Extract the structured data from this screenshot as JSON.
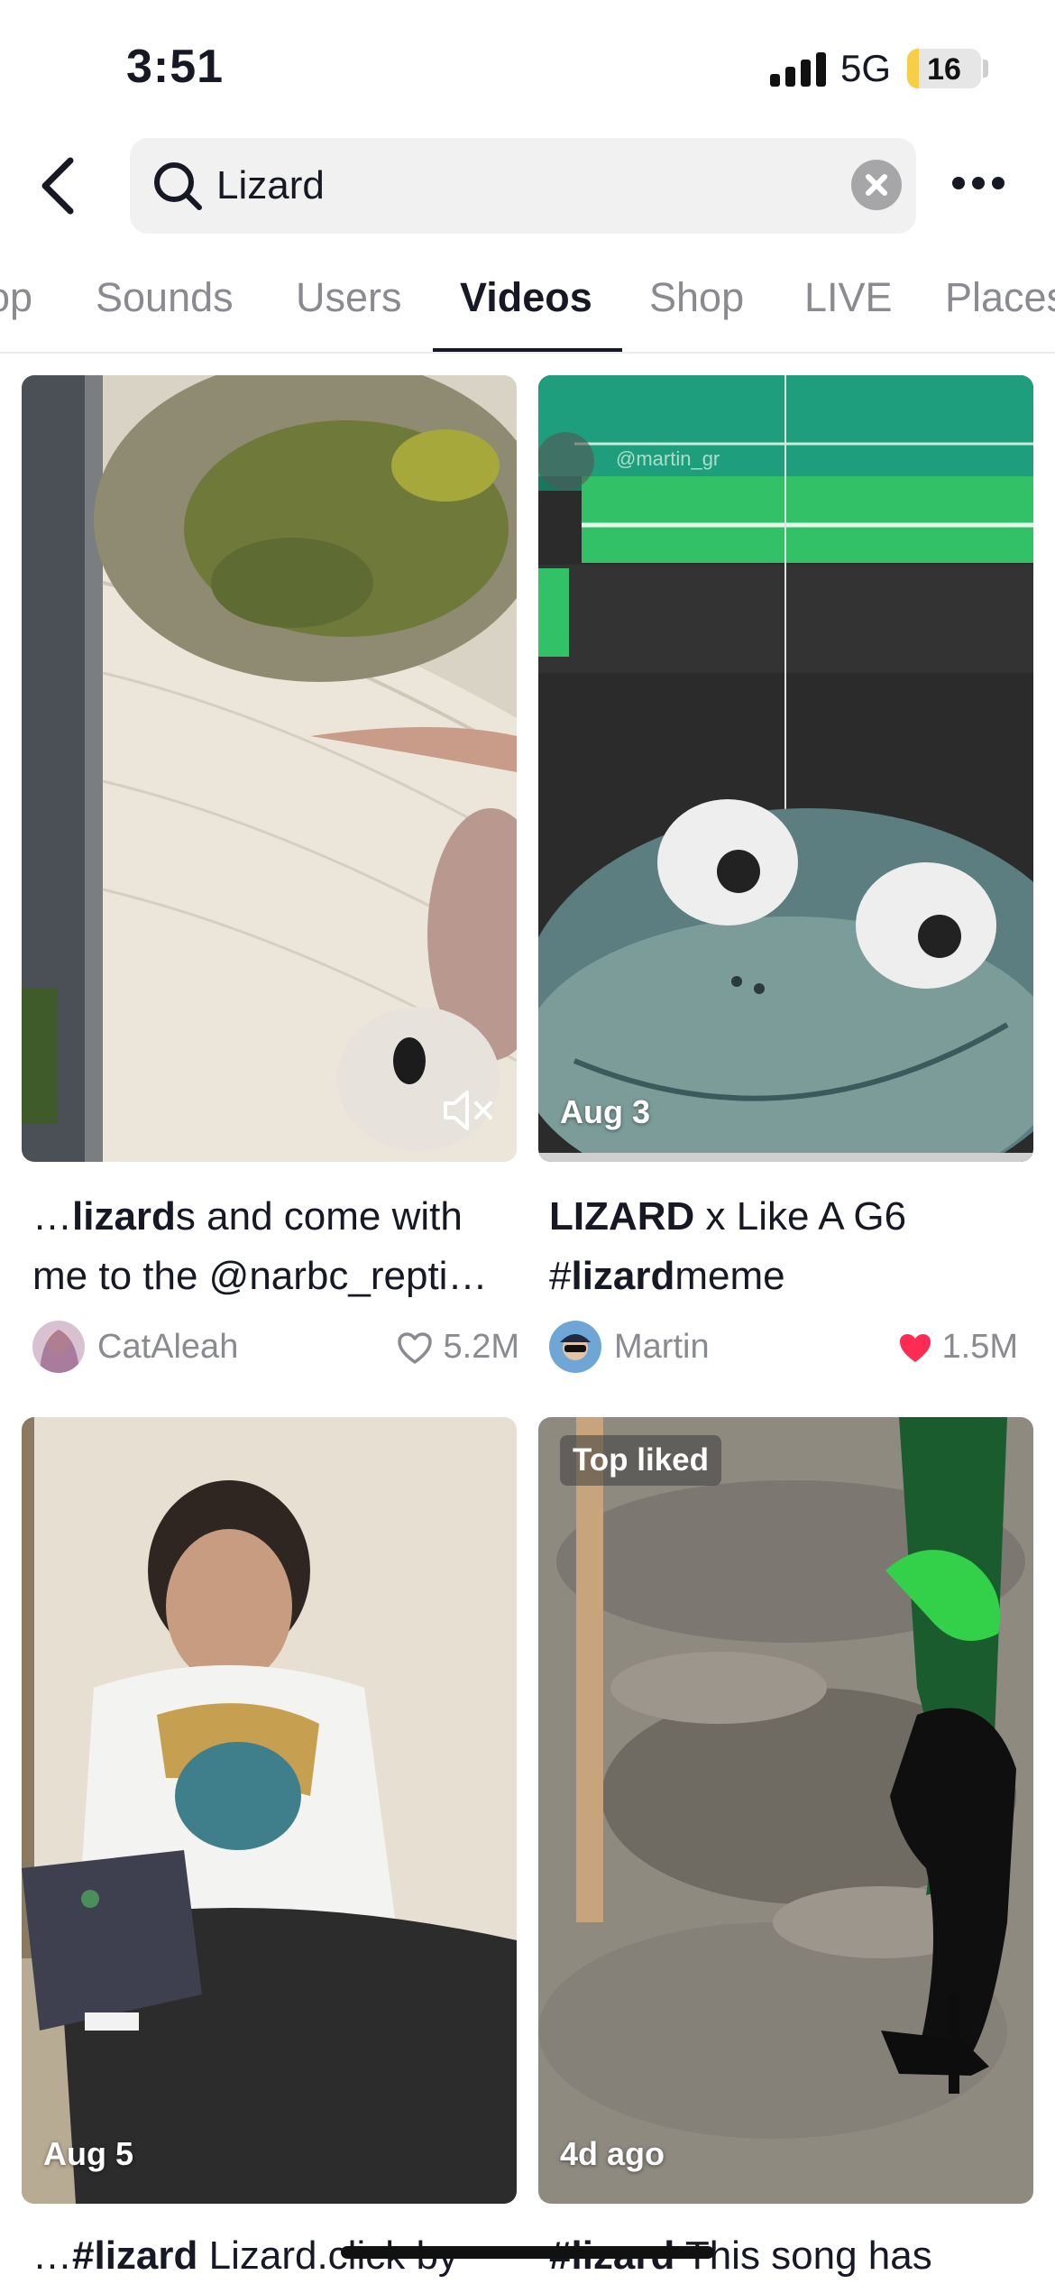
{
  "status_bar": {
    "time": "3:51",
    "network": "5G",
    "battery": "16",
    "battery_level": 0.16
  },
  "search": {
    "value": "Lizard",
    "icons": [
      "back-arrow-icon",
      "search-icon",
      "clear-icon",
      "more-icon"
    ]
  },
  "tabs": [
    {
      "label": "op",
      "active": false
    },
    {
      "label": "Sounds",
      "active": false
    },
    {
      "label": "Users",
      "active": false
    },
    {
      "label": "Videos",
      "active": true
    },
    {
      "label": "Shop",
      "active": false
    },
    {
      "label": "LIVE",
      "active": false
    },
    {
      "label": "Places",
      "active": false
    }
  ],
  "videos": [
    {
      "badge": "",
      "caption_parts": [
        "…",
        "lizard",
        "s and come with me to the @narbc_repti…"
      ],
      "author": "CatAleah",
      "likes": "5.2M",
      "liked": false,
      "muted": true
    },
    {
      "badge": "Aug 3",
      "watermark": "@martin_gr",
      "caption_parts": [
        "LIZARD",
        " x Like A G6 #",
        "lizard",
        "meme"
      ],
      "author": "Martin",
      "likes": "1.5M",
      "liked": true
    },
    {
      "badge": "Aug 5",
      "caption_parts": [
        "…",
        "#lizard",
        "  Lizard.click by"
      ]
    },
    {
      "top_label": "Top liked",
      "badge": "4d ago",
      "caption_parts": [
        "#lizard",
        " This song has"
      ]
    }
  ],
  "colors": {
    "liked_heart": "#fe2c55",
    "active_tab": "#161823",
    "inactive_tab": "#8a8b91",
    "search_bg": "#f1f1f2"
  }
}
